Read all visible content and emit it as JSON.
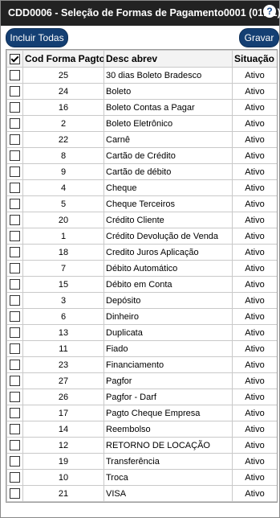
{
  "window": {
    "title": "CDD0006 - Seleção de Formas de Pagamento0001 (01.01)",
    "help_label": "?"
  },
  "toolbar": {
    "include_all_label": "Incluir Todas",
    "save_label": "Gravar"
  },
  "table": {
    "headers": {
      "code": "Cod Forma Pagto",
      "desc": "Desc abrev",
      "status": "Situação"
    },
    "rows": [
      {
        "code": "25",
        "desc": "30 dias Boleto Bradesco",
        "status": "Ativo"
      },
      {
        "code": "24",
        "desc": "Boleto",
        "status": "Ativo"
      },
      {
        "code": "16",
        "desc": "Boleto Contas a Pagar",
        "status": "Ativo"
      },
      {
        "code": "2",
        "desc": "Boleto Eletrônico",
        "status": "Ativo"
      },
      {
        "code": "22",
        "desc": "Carnê",
        "status": "Ativo"
      },
      {
        "code": "8",
        "desc": "Cartão de Crédito",
        "status": "Ativo"
      },
      {
        "code": "9",
        "desc": "Cartão de débito",
        "status": "Ativo"
      },
      {
        "code": "4",
        "desc": "Cheque",
        "status": "Ativo"
      },
      {
        "code": "5",
        "desc": "Cheque Terceiros",
        "status": "Ativo"
      },
      {
        "code": "20",
        "desc": "Crédito Cliente",
        "status": "Ativo"
      },
      {
        "code": "1",
        "desc": "Crédito Devolução de Venda",
        "status": "Ativo"
      },
      {
        "code": "18",
        "desc": "Credito Juros Aplicação",
        "status": "Ativo"
      },
      {
        "code": "7",
        "desc": "Débito Automático",
        "status": "Ativo"
      },
      {
        "code": "15",
        "desc": "Débito em Conta",
        "status": "Ativo"
      },
      {
        "code": "3",
        "desc": "Depósito",
        "status": "Ativo"
      },
      {
        "code": "6",
        "desc": "Dinheiro",
        "status": "Ativo"
      },
      {
        "code": "13",
        "desc": "Duplicata",
        "status": "Ativo"
      },
      {
        "code": "11",
        "desc": "Fiado",
        "status": "Ativo"
      },
      {
        "code": "23",
        "desc": "Financiamento",
        "status": "Ativo"
      },
      {
        "code": "27",
        "desc": "Pagfor",
        "status": "Ativo"
      },
      {
        "code": "26",
        "desc": "Pagfor - Darf",
        "status": "Ativo"
      },
      {
        "code": "17",
        "desc": "Pagto Cheque Empresa",
        "status": "Ativo"
      },
      {
        "code": "14",
        "desc": "Reembolso",
        "status": "Ativo"
      },
      {
        "code": "12",
        "desc": "RETORNO DE LOCAÇÃO",
        "status": "Ativo"
      },
      {
        "code": "19",
        "desc": "Transferência",
        "status": "Ativo"
      },
      {
        "code": "10",
        "desc": "Troca",
        "status": "Ativo"
      },
      {
        "code": "21",
        "desc": "VISA",
        "status": "Ativo"
      }
    ]
  },
  "colors": {
    "titlebar_bg": "#222222",
    "button_bg": "#143f73",
    "header_bg": "#f3f3f3"
  },
  "icons": {
    "help": "help-icon",
    "select_all": "checkbox-icon"
  }
}
